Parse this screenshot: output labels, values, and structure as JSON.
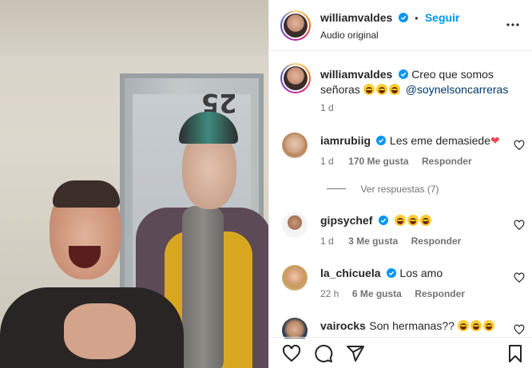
{
  "post": {
    "author": "williamvaldes",
    "follow_label": "Seguir",
    "separator": "•",
    "audio_label": "Audio original",
    "door_number": "25"
  },
  "caption": {
    "username": "williamvaldes",
    "text": "Creo que somos señoras",
    "mention": "@soynelsoncarreras",
    "time": "1 d"
  },
  "comments": [
    {
      "username": "iamrubiig",
      "text": "Les eme demasiede",
      "time": "1 d",
      "likes": "170 Me gusta",
      "reply_label": "Responder",
      "view_replies": "Ver respuestas (7)"
    },
    {
      "username": "gipsychef",
      "text": "",
      "time": "1 d",
      "likes": "3 Me gusta",
      "reply_label": "Responder"
    },
    {
      "username": "la_chicuela",
      "text": "Los amo",
      "time": "22 h",
      "likes": "6 Me gusta",
      "reply_label": "Responder"
    },
    {
      "username": "vairocks",
      "text": "Son hermanas??"
    }
  ],
  "icons": {
    "verified": "verified-badge-icon",
    "more": "more-options-icon",
    "like": "heart-outline-icon",
    "comment": "comment-icon",
    "share": "send-icon",
    "save": "bookmark-icon"
  },
  "colors": {
    "link_blue": "#0095f6",
    "verified_blue": "#0095f6",
    "mention_blue": "#00376b",
    "muted_text": "#737373",
    "heart_red": "#ed4956"
  }
}
